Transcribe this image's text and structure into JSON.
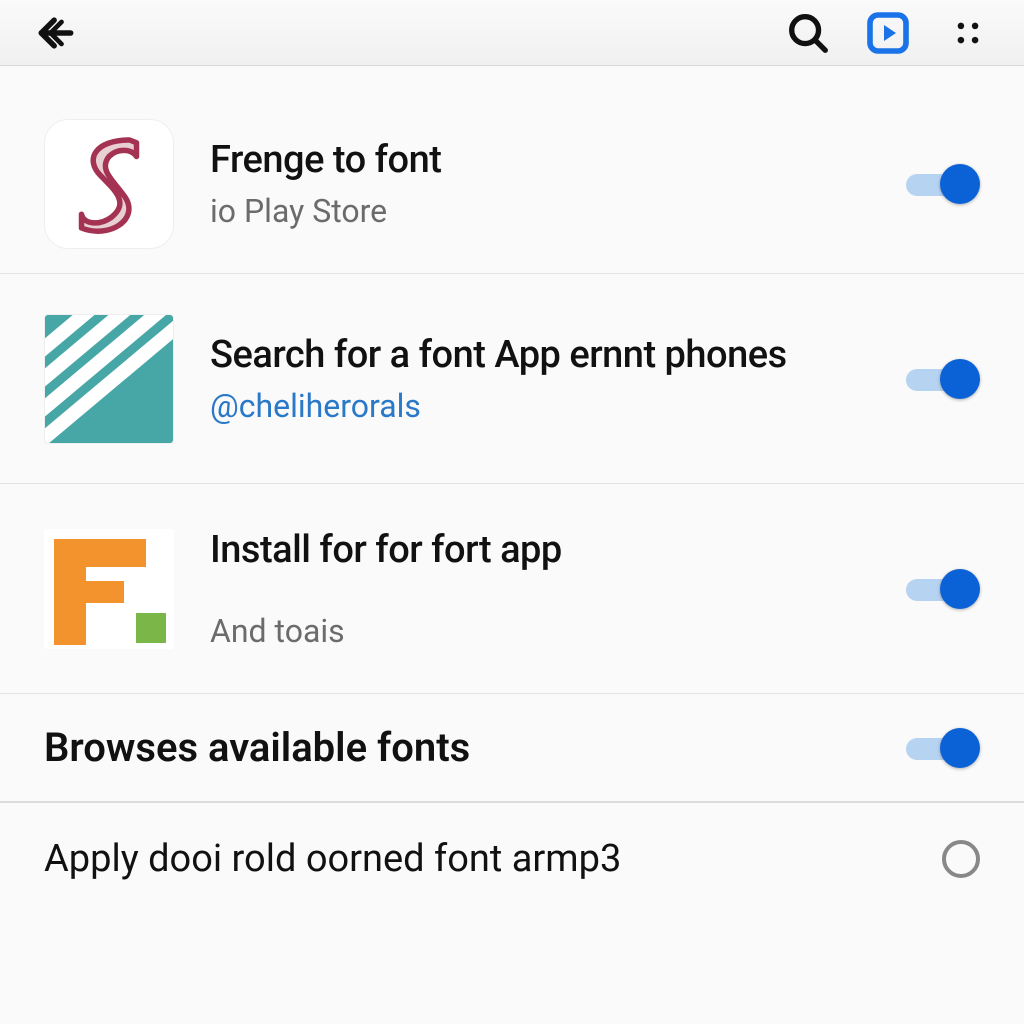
{
  "header": {
    "back_label": "Back",
    "search_label": "Search",
    "action_label": "Open",
    "more_label": "More"
  },
  "items": [
    {
      "title": "Frenge to font",
      "subtitle": "io Play Store",
      "toggle": true,
      "is_link": false,
      "icon": "s"
    },
    {
      "title": "Search for a font App ernnt phones",
      "subtitle": "@cheliherorals",
      "toggle": true,
      "is_link": true,
      "icon": "teal"
    },
    {
      "title": "Install for for fort app",
      "subtitle": "And toais",
      "toggle": true,
      "is_link": false,
      "icon": "f"
    }
  ],
  "section": {
    "title": "Browses available fonts",
    "toggle": true
  },
  "bottom": {
    "title": "Apply dooi rold oorned font armp3",
    "radio": false
  },
  "colors": {
    "accent": "#0b62d6",
    "link": "#2a78c8"
  }
}
